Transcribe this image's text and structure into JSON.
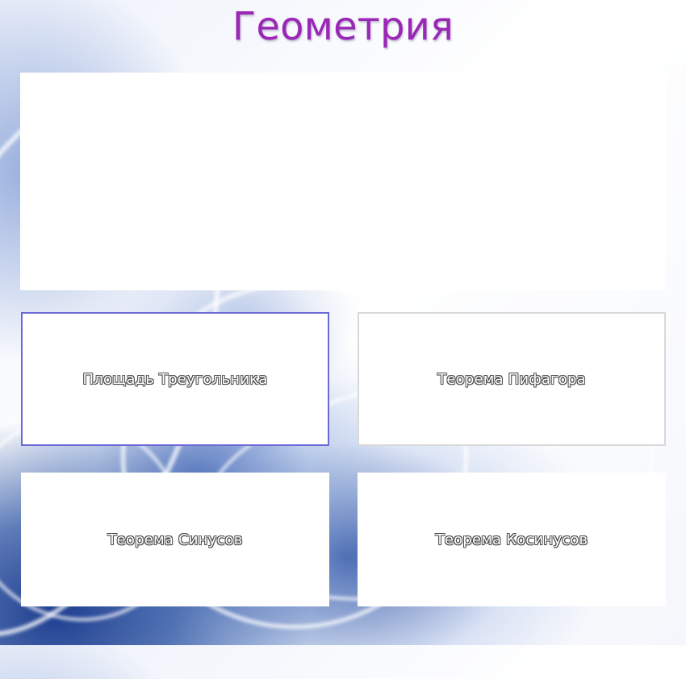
{
  "page": {
    "title": "Геометрия",
    "accent_color": "#9b27b6"
  },
  "topics": [
    {
      "label": "Площадь Треугольника",
      "selected": true
    },
    {
      "label": "Теорема Пифагора",
      "selected": false
    },
    {
      "label": "Теорема Синусов",
      "selected": false
    },
    {
      "label": "Теорема Косинусов",
      "selected": false
    }
  ]
}
